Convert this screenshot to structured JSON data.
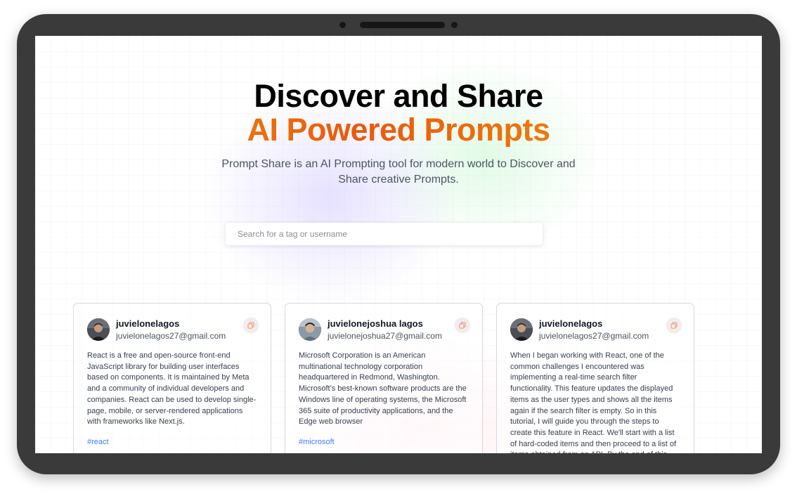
{
  "hero": {
    "title_line1": "Discover and Share",
    "title_line2": "AI Powered Prompts",
    "description": "Prompt Share is an AI Prompting tool for modern world to Discover and Share creative Prompts."
  },
  "search": {
    "placeholder": "Search for a tag or username",
    "value": ""
  },
  "cards": [
    {
      "username": "juvielonelagos",
      "email": "juvielonelagos27@gmail.com",
      "prompt": "React is a free and open-source front-end JavaScript library for building user interfaces based on components. It is maintained by Meta and a community of individual developers and companies. React can be used to develop single-page, mobile, or server-rendered applications with frameworks like Next.js.",
      "tag": "#react"
    },
    {
      "username": "juvielonejoshua lagos",
      "email": "juvielonejoshua27@gmail.com",
      "prompt": "Microsoft Corporation is an American multinational technology corporation headquartered in Redmond, Washington. Microsoft's best-known software products are the Windows line of operating systems, the Microsoft 365 suite of productivity applications, and the Edge web browser",
      "tag": "#microsoft"
    },
    {
      "username": "juvielonelagos",
      "email": "juvielonelagos27@gmail.com",
      "prompt": "When I began working with React, one of the common challenges I encountered was implementing a real-time search filter functionality. This feature updates the displayed items as the user types and shows all the items again if the search filter is empty. So in this tutorial, I will guide you through the steps to create this feature in React. We'll start with a list of hard-coded items and then proceed to a list of items obtained from an API. By the end of this",
      "tag": ""
    }
  ],
  "icons": {
    "copy": "copy-icon",
    "avatar": "user-avatar"
  },
  "colors": {
    "accent_orange": "#ea580c",
    "accent_amber": "#f59e0b",
    "tag_blue": "#3b82f6",
    "device_frame": "#3a3a3a"
  }
}
